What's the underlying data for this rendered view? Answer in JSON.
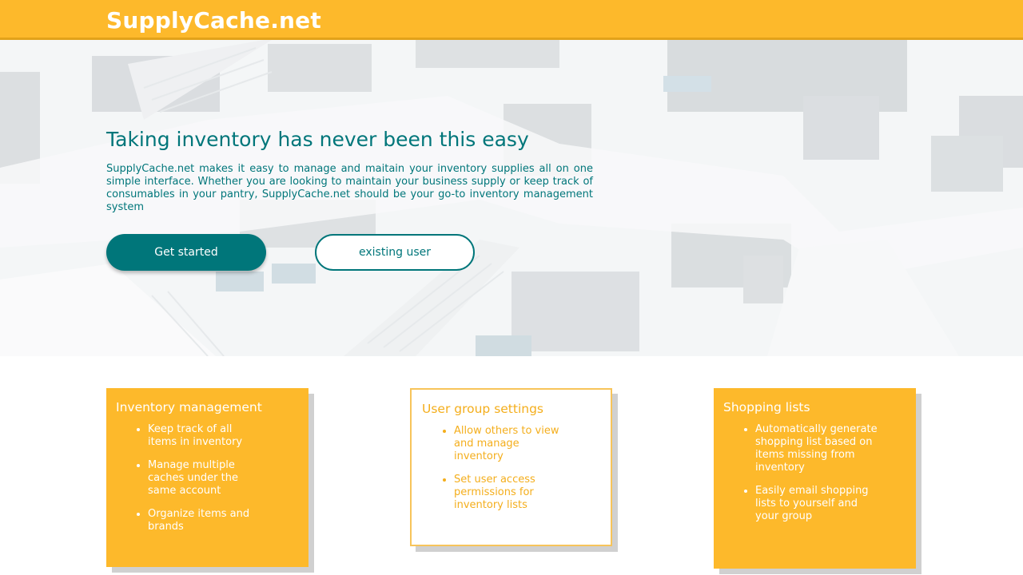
{
  "header": {
    "logo": "SupplyCache.net"
  },
  "hero": {
    "title": "Taking inventory has never been this easy",
    "description": "SupplyCache.net makes it easy to manage and maitain your inventory supplies all on one simple interface. Whether you are looking to maintain your business supply or keep track of consumables in your pantry, SupplyCache.net should be your go-to inventory management system",
    "primary_button": "Get started",
    "secondary_button": "existing user"
  },
  "features": [
    {
      "title": "Inventory management",
      "items": [
        "Keep track of all items in inventory",
        "Manage multiple caches under the same account",
        "Organize items and brands"
      ]
    },
    {
      "title": "User group settings",
      "items": [
        "Allow others to view and manage inventory",
        "Set user access permissions for inventory lists"
      ]
    },
    {
      "title": "Shopping lists",
      "items": [
        "Automatically generate shopping list based on items missing from inventory",
        "Easily email shopping lists to yourself and your group"
      ]
    }
  ],
  "colors": {
    "brand_yellow": "#fdb92b",
    "brand_teal": "#00767a"
  }
}
